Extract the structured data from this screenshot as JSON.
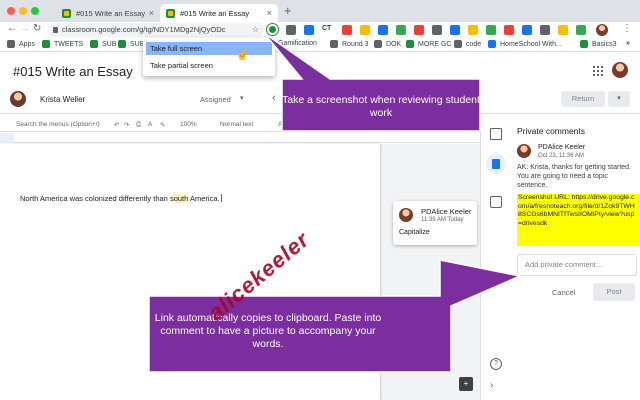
{
  "browser": {
    "tabs": [
      {
        "label": "#015 Write an Essay"
      },
      {
        "label": "#015 Write an Essay"
      }
    ],
    "new_tab": "+",
    "close": "×",
    "url": "classroom.google.com/g/tg/NDY1MDg2NjQyODc",
    "star": "☆",
    "window_colors": [
      "#ff5f57",
      "#febc2e",
      "#28c840"
    ]
  },
  "bookmarks": [
    {
      "label": "Apps",
      "color": "#5f6368"
    },
    {
      "label": "TWEETS",
      "color": "#1e8e3e"
    },
    {
      "label": "SUB",
      "color": "#1e8e3e"
    },
    {
      "label": "SUB",
      "color": "#1e8e3e"
    },
    {
      "label": "Gamification",
      "color": "#34a853"
    },
    {
      "label": "Round 3",
      "color": "#5f6368"
    },
    {
      "label": "DOK",
      "color": "#5f6368"
    },
    {
      "label": "MORE GC",
      "color": "#1e8e3e"
    },
    {
      "label": "code",
      "color": "#5f6368"
    },
    {
      "label": "HomeSchool With...",
      "color": "#1a73e8"
    },
    {
      "label": "Basics3",
      "color": "#1e8e3e"
    }
  ],
  "extension_icons": [
    "CT"
  ],
  "screenshot_menu": {
    "items": [
      "Take full screen",
      "Take partial screen"
    ]
  },
  "classroom": {
    "title": "#015 Write an Essay",
    "student_name": "Krista Weller",
    "status": "Assigned",
    "return_label": "Return",
    "dropdown_caret": "▾",
    "prev_arrow": "‹"
  },
  "docs_toolbar": {
    "search": "Search the menus (Option+/)",
    "zoom": "100%",
    "style": "Normal text",
    "font_prefix": "A"
  },
  "document": {
    "text_before": "North America was colonized differently than ",
    "highlighted": "south",
    "text_after": " America."
  },
  "doc_comment": {
    "author": "PDAlice Keeler",
    "time": "11:39 AM Today",
    "body": "Capitalize"
  },
  "private_comments": {
    "title": "Private comments",
    "author": "PDAlice Keeler",
    "time": "Oct 23, 11:36 AM",
    "text": "AK: Krista, thanks for getting started. You are going to need a topic sentence.",
    "url_text": "Screenshot URL: https://drive.google.com/a/fresnoteach.org/file/d/1Zok9TWH8SCGs6bMNITfTwsIIOMlPty/view?usp=drivesdk",
    "placeholder": "Add private comment...",
    "cancel": "Cancel",
    "post": "Post"
  },
  "callouts": [
    {
      "text": "Take a screenshot when reviewing student work"
    },
    {
      "text": "Link automatically copies to clipboard. Paste into comment to have a picture to accompany your words."
    }
  ],
  "watermark": "alicekeeler",
  "colors": {
    "callout_purple": "#7b2f9e",
    "highlight_yellow": "#ffff00",
    "selected_blue": "#8ab4f8"
  }
}
